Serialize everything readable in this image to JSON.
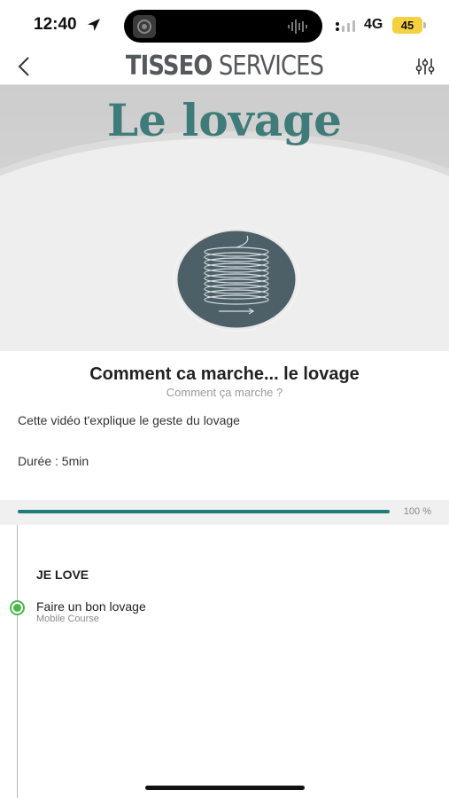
{
  "status_bar": {
    "time": "12:40",
    "network": "4G",
    "battery": "45"
  },
  "nav": {
    "brand_bold": "TISSEO",
    "brand_light": " SERVICES"
  },
  "hero": {
    "title": "Le lovage"
  },
  "course": {
    "title": "Comment ca marche... le lovage",
    "subtitle": "Comment ça marche ?",
    "description": "Cette vidéo t'explique le geste du lovage",
    "duration": "Durée : 5min"
  },
  "progress": {
    "percent": 100,
    "label": "100 %"
  },
  "timeline": {
    "section_title": "JE LOVE",
    "items": [
      {
        "title": "Faire un bon lovage",
        "type": "Mobile Course",
        "status": "completed"
      }
    ]
  },
  "colors": {
    "accent": "#1e7d7a",
    "title_teal": "#3f7b78",
    "completed_green": "#4cb648",
    "coil_disc": "#4d5f67"
  }
}
